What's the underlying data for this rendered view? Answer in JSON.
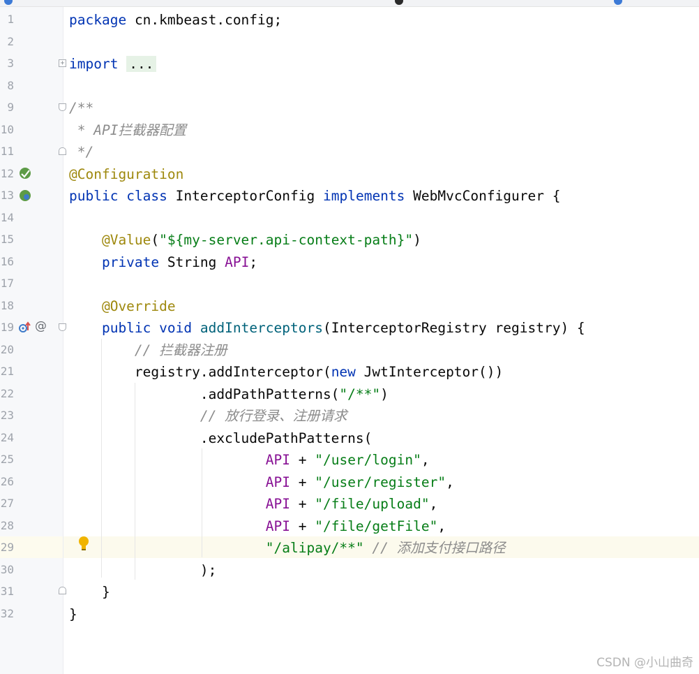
{
  "editor": {
    "lines": [
      {
        "n": "1",
        "segs": [
          [
            "kw",
            "package"
          ],
          [
            "",
            "cn.kmbeast.config;"
          ]
        ]
      },
      {
        "n": "2",
        "segs": []
      },
      {
        "n": "3",
        "segs": [
          [
            "kw",
            "import"
          ],
          [
            "",
            ""
          ],
          [
            "fold",
            "..."
          ]
        ]
      },
      {
        "n": "8",
        "segs": []
      },
      {
        "n": "9",
        "segs": [
          [
            "cmt",
            "/**"
          ]
        ]
      },
      {
        "n": "10",
        "segs": [
          [
            "cmt",
            " * API拦截器配置"
          ]
        ]
      },
      {
        "n": "11",
        "segs": [
          [
            "cmt",
            " */"
          ]
        ]
      },
      {
        "n": "12",
        "segs": [
          [
            "ann",
            "@Configuration"
          ]
        ]
      },
      {
        "n": "13",
        "segs": [
          [
            "kw",
            "public"
          ],
          [
            "",
            ""
          ],
          [
            "kw",
            "class"
          ],
          [
            "",
            "InterceptorConfig"
          ],
          [
            "kw",
            "implements"
          ],
          [
            "",
            "WebMvcConfigurer {"
          ]
        ]
      },
      {
        "n": "14",
        "segs": []
      },
      {
        "n": "15",
        "segs": [
          [
            "ann",
            "    @Value"
          ],
          [
            "",
            "("
          ],
          [
            "str",
            "\"${my-server.api-context-path}\""
          ],
          [
            "",
            ")"
          ]
        ]
      },
      {
        "n": "16",
        "segs": [
          [
            "kw",
            "    private"
          ],
          [
            "",
            "String"
          ],
          [
            "fld",
            "API"
          ],
          [
            "",
            ";"
          ]
        ]
      },
      {
        "n": "17",
        "segs": []
      },
      {
        "n": "18",
        "segs": [
          [
            "ann",
            "    @Override"
          ]
        ]
      },
      {
        "n": "19",
        "segs": [
          [
            "kw",
            "    public"
          ],
          [
            "kw",
            "void"
          ],
          [
            "mth",
            "addInterceptors"
          ],
          [
            "",
            "(InterceptorRegistry registry) {"
          ]
        ]
      },
      {
        "n": "20",
        "segs": [
          [
            "cmt",
            "        // 拦截器注册"
          ]
        ]
      },
      {
        "n": "21",
        "segs": [
          [
            "",
            "        registry.addInterceptor("
          ],
          [
            "kw",
            "new"
          ],
          [
            "",
            "JwtInterceptor())"
          ]
        ]
      },
      {
        "n": "22",
        "segs": [
          [
            "",
            "                .addPathPatterns("
          ],
          [
            "str",
            "\"/**\""
          ],
          [
            "",
            ")"
          ]
        ]
      },
      {
        "n": "23",
        "segs": [
          [
            "cmt",
            "                // 放行登录、注册请求"
          ]
        ]
      },
      {
        "n": "24",
        "segs": [
          [
            "",
            "                .excludePathPatterns("
          ]
        ]
      },
      {
        "n": "25",
        "segs": [
          [
            "fld",
            "                        API"
          ],
          [
            "",
            "+"
          ],
          [
            "str",
            "\"/user/login\""
          ],
          [
            "",
            ","
          ]
        ]
      },
      {
        "n": "26",
        "segs": [
          [
            "fld",
            "                        API"
          ],
          [
            "",
            "+"
          ],
          [
            "str",
            "\"/user/register\""
          ],
          [
            "",
            ","
          ]
        ]
      },
      {
        "n": "27",
        "segs": [
          [
            "fld",
            "                        API"
          ],
          [
            "",
            "+"
          ],
          [
            "str",
            "\"/file/upload\""
          ],
          [
            "",
            ","
          ]
        ]
      },
      {
        "n": "28",
        "segs": [
          [
            "fld",
            "                        API"
          ],
          [
            "",
            "+"
          ],
          [
            "str",
            "\"/file/getFile\""
          ],
          [
            "",
            ","
          ]
        ]
      },
      {
        "n": "29",
        "segs": [
          [
            "str",
            "                        \"/alipay/**\""
          ],
          [
            "cmt",
            "// 添加支付接口路径"
          ]
        ]
      },
      {
        "n": "30",
        "segs": [
          [
            "",
            "                );"
          ]
        ]
      },
      {
        "n": "31",
        "segs": [
          [
            "",
            "    }"
          ]
        ]
      },
      {
        "n": "32",
        "segs": [
          [
            "",
            "}"
          ]
        ]
      }
    ],
    "highlighted_line": "29",
    "gutter_icons": {
      "line12": "spring-bean-icon",
      "line13": "spring-config-icon",
      "line19_a": "override-method-icon",
      "line19_b": "at-annotation-icon",
      "line29": "lightbulb-intention-icon"
    },
    "colors": {
      "keyword": "#0033b3",
      "annotation": "#9e880d",
      "string": "#067d17",
      "field": "#871094",
      "comment": "#8c8c8c",
      "method": "#00627a",
      "highlight": "#fcfaed"
    }
  },
  "watermark": "CSDN @小山曲奇"
}
